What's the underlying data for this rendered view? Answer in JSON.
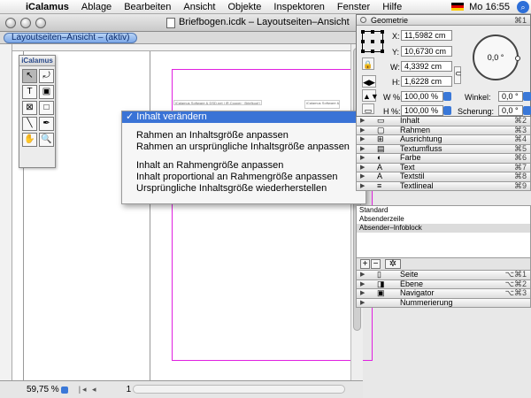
{
  "menubar": {
    "apple": "",
    "app": "iCalamus",
    "items": [
      "Ablage",
      "Bearbeiten",
      "Ansicht",
      "Objekte",
      "Inspektoren",
      "Fenster",
      "Hilfe"
    ],
    "clock": "Mo 16:55"
  },
  "document": {
    "title": "Briefbogen.icdk – Layoutseiten–Ansicht",
    "view_tab": "Layoutseiten–Ansicht – (aktiv)",
    "zoom": "59,75 %",
    "page": "1",
    "tiny_text_1": "iCalamus Software & DSD.net | iR.Cooper · Briefkopf | Arpent · Zeile",
    "tiny_text_2": "iCalamus Software & DSD.net\nUSt-Id · Konto"
  },
  "tools": {
    "title": "iCalamus",
    "items": [
      {
        "name": "arrow-tool-icon",
        "glyph": "↖",
        "active": true
      },
      {
        "name": "rotate-tool-icon",
        "glyph": "⤾",
        "active": false
      },
      {
        "name": "text-tool-icon",
        "glyph": "T",
        "active": false
      },
      {
        "name": "image-tool-icon",
        "glyph": "▣",
        "active": false
      },
      {
        "name": "frame-tool-icon",
        "glyph": "⊠",
        "active": false
      },
      {
        "name": "rect-tool-icon",
        "glyph": "□",
        "active": false
      },
      {
        "name": "line-tool-icon",
        "glyph": "╲",
        "active": false
      },
      {
        "name": "pen-tool-icon",
        "glyph": "✒",
        "active": false
      },
      {
        "name": "hand-tool-icon",
        "glyph": "✋",
        "active": false
      },
      {
        "name": "zoom-tool-icon",
        "glyph": "🔍",
        "active": false
      }
    ]
  },
  "popup": {
    "items": [
      {
        "label": "✓ Inhalt verändern",
        "highlighted": true
      },
      {
        "sep": true
      },
      {
        "label": "Rahmen an Inhaltsgröße anpassen"
      },
      {
        "label": "Rahmen an ursprüngliche Inhaltsgröße anpassen"
      },
      {
        "sep": true
      },
      {
        "label": "Inhalt an Rahmengröße anpassen"
      },
      {
        "label": "Inhalt proportional an Rahmengröße anpassen"
      },
      {
        "label": "Ursprüngliche Inhaltsgröße wiederherstellen"
      }
    ]
  },
  "geometry": {
    "title": "Geometrie",
    "shortcut": "⌘1",
    "x_label": "X:",
    "x_value": "11,5982 cm",
    "y_label": "Y:",
    "y_value": "10,6730 cm",
    "w_label": "W:",
    "w_value": "4,3392 cm",
    "h_label": "H:",
    "h_value": "1,6228 cm",
    "scale_w_label": "W %:",
    "scale_w_value": "100,00 %",
    "scale_h_label": "H %:",
    "scale_h_value": "100,00 %",
    "angle_label": "Winkel:",
    "angle_value": "0,0 °",
    "shear_label": "Scherung:",
    "shear_value": "0,0 °",
    "dial_value": "0,0 °"
  },
  "palettes": [
    {
      "name": "Inhalt",
      "icon": "▭",
      "shortcut": "⌘2"
    },
    {
      "name": "Rahmen",
      "icon": "▢",
      "shortcut": "⌘3"
    },
    {
      "name": "Ausrichtung",
      "icon": "⊞",
      "shortcut": "⌘4"
    },
    {
      "name": "Textumfluss",
      "icon": "▤",
      "shortcut": "⌘5"
    },
    {
      "name": "Farbe",
      "icon": "◐",
      "shortcut": "⌘6"
    },
    {
      "name": "Text",
      "icon": "A",
      "shortcut": "⌘7"
    },
    {
      "name": "Textstil",
      "icon": "A",
      "shortcut": "⌘8"
    },
    {
      "name": "Textlineal",
      "icon": "≡",
      "shortcut": "⌘9"
    }
  ],
  "styles": {
    "items": [
      "Standard",
      "Absenderzeile",
      "Absender–Infoblock"
    ],
    "selected": 2,
    "add": "+",
    "remove": "−",
    "gear": "✲"
  },
  "palettes2": [
    {
      "name": "Seite",
      "icon": "▯",
      "shortcut": "⌥⌘1"
    },
    {
      "name": "Ebene",
      "icon": "◨",
      "shortcut": "⌥⌘2"
    },
    {
      "name": "Navigator",
      "icon": "▣",
      "shortcut": "⌥⌘3"
    },
    {
      "name": "Nummerierung",
      "icon": "",
      "shortcut": ""
    }
  ],
  "colors": {
    "highlight": "#3a73d6",
    "page_frame": "#e020e0",
    "accent": "#3a78d8"
  }
}
